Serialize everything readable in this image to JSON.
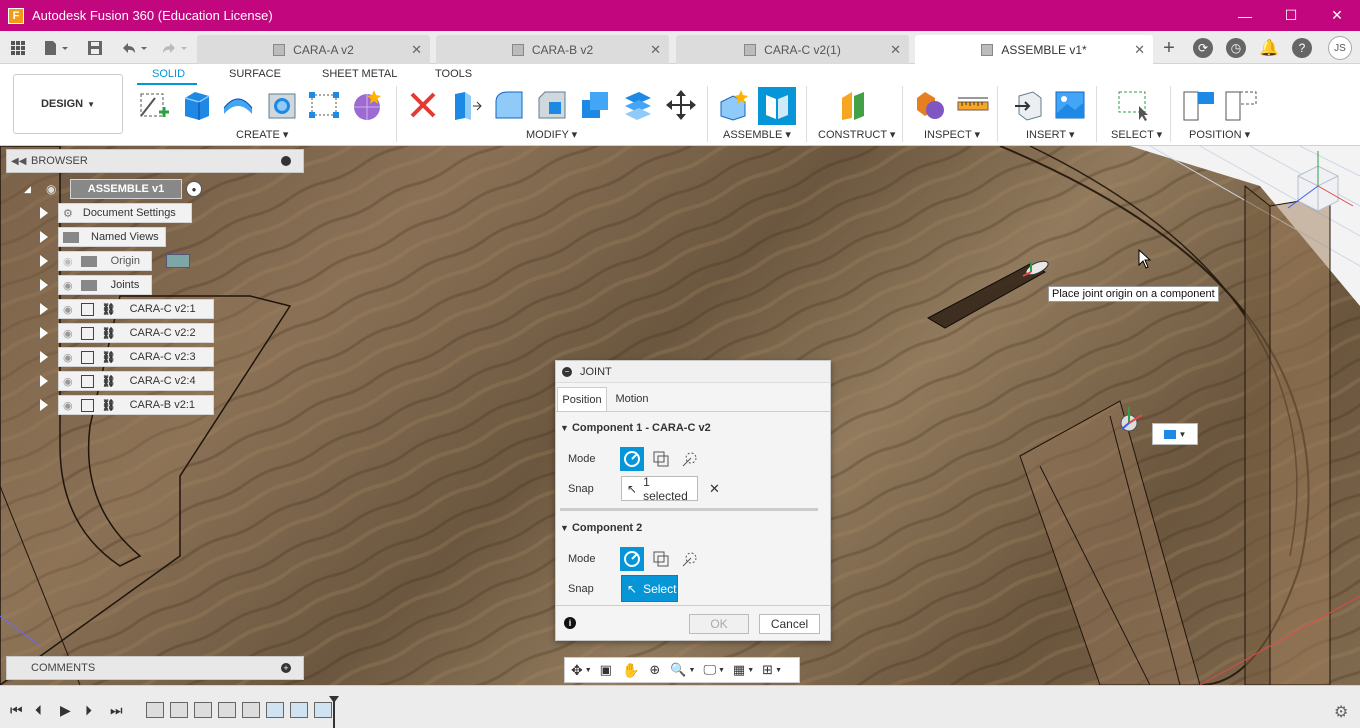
{
  "window": {
    "title": "Autodesk Fusion 360 (Education License)",
    "app_icon_letter": "F",
    "minimize": "—",
    "maximize": "☐",
    "close": "✕"
  },
  "tabs": [
    {
      "label": "CARA-A v2",
      "active": false
    },
    {
      "label": "CARA-B v2",
      "active": false
    },
    {
      "label": "CARA-C v2(1)",
      "active": false
    },
    {
      "label": "ASSEMBLE v1*",
      "active": true
    }
  ],
  "user_initials": "JS",
  "workspace": {
    "mode": "DESIGN",
    "tabs": [
      "SOLID",
      "SURFACE",
      "SHEET METAL",
      "TOOLS"
    ]
  },
  "toolbar_groups": {
    "create": "CREATE",
    "modify": "MODIFY",
    "assemble": "ASSEMBLE",
    "construct": "CONSTRUCT",
    "inspect": "INSPECT",
    "insert": "INSERT",
    "select": "SELECT",
    "position": "POSITION"
  },
  "browser": {
    "title": "BROWSER",
    "root": "ASSEMBLE v1",
    "items": [
      {
        "label": "Document Settings"
      },
      {
        "label": "Named Views"
      },
      {
        "label": "Origin"
      },
      {
        "label": "Joints"
      },
      {
        "label": "CARA-C v2:1"
      },
      {
        "label": "CARA-C v2:2"
      },
      {
        "label": "CARA-C v2:3"
      },
      {
        "label": "CARA-C v2:4"
      },
      {
        "label": "CARA-B v2:1"
      }
    ]
  },
  "comments": {
    "title": "COMMENTS"
  },
  "tooltip": "Place joint origin on a component",
  "joint_dialog": {
    "title": "JOINT",
    "tabs": [
      "Position",
      "Motion"
    ],
    "component1": {
      "title": "Component 1 - CARA-C v2",
      "mode_label": "Mode",
      "snap_label": "Snap",
      "snap_value": "1 selected"
    },
    "component2": {
      "title": "Component 2",
      "mode_label": "Mode",
      "snap_label": "Snap",
      "snap_value": "Select"
    },
    "ok": "OK",
    "cancel": "Cancel"
  },
  "colors": {
    "titlebar": "#c2077e",
    "accent": "#0696d7"
  }
}
